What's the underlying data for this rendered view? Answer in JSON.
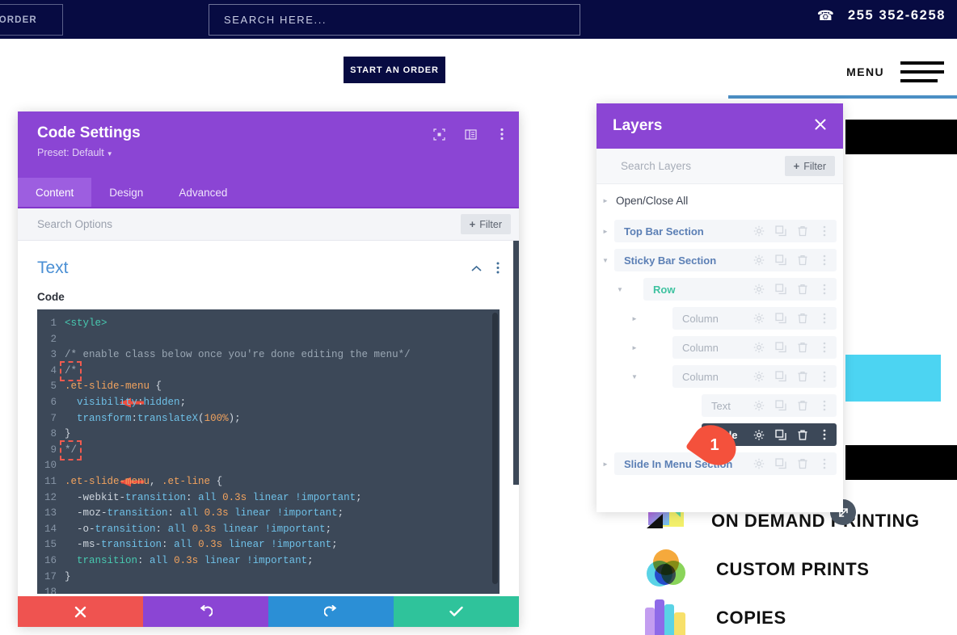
{
  "site": {
    "topbar": {
      "order_button": "RT AN ORDER",
      "search_placeholder": "SEARCH HERE...",
      "phone_icon": "phone-icon",
      "phone": "255 352-6258"
    },
    "header": {
      "order_button": "START AN ORDER",
      "menu_label": "MENU",
      "hamburger_icon": "hamburger-icon"
    },
    "services": [
      {
        "label": "ON DEMAND PRINTING",
        "icon": "on-demand-printing-icon"
      },
      {
        "label": "CUSTOM PRINTS",
        "icon": "custom-prints-icon"
      },
      {
        "label": "COPIES",
        "icon": "copies-icon"
      }
    ],
    "resize_handle_icon": "resize-diagonal-icon",
    "colors": {
      "navy": "#070b42",
      "cyan_block": "#4cd4f2",
      "underline_blue": "#4b8fc4"
    }
  },
  "modal": {
    "title": "Code Settings",
    "preset": "Preset: Default",
    "head_icons": [
      "fullscreen-icon",
      "split-view-icon",
      "kebab-menu-icon"
    ],
    "tabs": [
      {
        "label": "Content",
        "active": true
      },
      {
        "label": "Design",
        "active": false
      },
      {
        "label": "Advanced",
        "active": false
      }
    ],
    "search_placeholder": "Search Options",
    "filter_label": "Filter",
    "filter_plus": "+",
    "section": {
      "title": "Text",
      "collapse_icon": "chevron-up-icon",
      "kebab_icon": "kebab-menu-icon"
    },
    "field_label": "Code",
    "actions": [
      {
        "name": "cancel",
        "icon": "close-icon",
        "color": "#ef5350"
      },
      {
        "name": "undo",
        "icon": "undo-icon",
        "color": "#8B45D4"
      },
      {
        "name": "redo",
        "icon": "redo-icon",
        "color": "#2b8fd6"
      },
      {
        "name": "save",
        "icon": "check-icon",
        "color": "#2fc39b"
      }
    ],
    "code_lines": [
      {
        "n": "1",
        "text": "<style>"
      },
      {
        "n": "2",
        "text": ""
      },
      {
        "n": "3",
        "text": "/* enable class below once you're done editing the menu*/"
      },
      {
        "n": "4",
        "text": "/*",
        "highlighted": true,
        "arrow": true
      },
      {
        "n": "5",
        "text": ".et-slide-menu {"
      },
      {
        "n": "6",
        "text": "  visibility:hidden;"
      },
      {
        "n": "7",
        "text": "  transform:translateX(100%);"
      },
      {
        "n": "8",
        "text": "}"
      },
      {
        "n": "9",
        "text": "*/",
        "highlighted": true,
        "arrow": true
      },
      {
        "n": "10",
        "text": ""
      },
      {
        "n": "11",
        "text": ".et-slide-menu, .et-line {"
      },
      {
        "n": "12",
        "text": "  -webkit-transition: all 0.3s linear !important;"
      },
      {
        "n": "13",
        "text": "  -moz-transition: all 0.3s linear !important;"
      },
      {
        "n": "14",
        "text": "  -o-transition: all 0.3s linear !important;"
      },
      {
        "n": "15",
        "text": "  -ms-transition: all 0.3s linear !important;"
      },
      {
        "n": "16",
        "text": "  transition: all 0.3s linear !important;"
      },
      {
        "n": "17",
        "text": "}"
      },
      {
        "n": "18",
        "text": ""
      }
    ]
  },
  "layers": {
    "title": "Layers",
    "close_icon": "close-icon",
    "search_placeholder": "Search Layers",
    "filter_label": "Filter",
    "open_close_all": "Open/Close All",
    "row_icons": [
      "gear-icon",
      "duplicate-icon",
      "trash-icon",
      "kebab-menu-icon"
    ],
    "items": [
      {
        "label": "Top Bar Section",
        "indent": 0,
        "type": "section",
        "twisty": "collapsed"
      },
      {
        "label": "Sticky Bar Section",
        "indent": 0,
        "type": "section",
        "twisty": "expanded"
      },
      {
        "label": "Row",
        "indent": 1,
        "type": "row",
        "twisty": "expanded"
      },
      {
        "label": "Column",
        "indent": 2,
        "type": "muted",
        "twisty": "collapsed"
      },
      {
        "label": "Column",
        "indent": 2,
        "type": "muted",
        "twisty": "collapsed"
      },
      {
        "label": "Column",
        "indent": 2,
        "type": "muted",
        "twisty": "expanded"
      },
      {
        "label": "Text",
        "indent": 3,
        "type": "muted",
        "twisty": "none"
      },
      {
        "label": "Code",
        "indent": 3,
        "type": "muted",
        "twisty": "none",
        "selected": true,
        "add_plus": "+"
      },
      {
        "label": "Slide In Menu Section",
        "indent": 0,
        "type": "section",
        "twisty": "collapsed"
      }
    ]
  },
  "annotation": {
    "number": "1"
  }
}
